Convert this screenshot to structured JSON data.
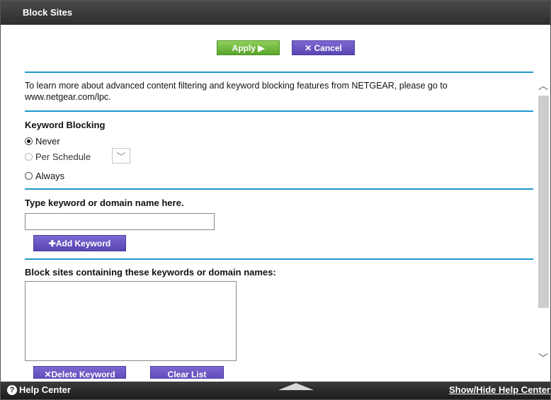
{
  "window": {
    "title": "Block Sites"
  },
  "toolbar": {
    "apply_label": "Apply",
    "apply_icon": "play-icon",
    "cancel_label": "Cancel",
    "cancel_icon": "x-icon"
  },
  "info": {
    "text": "To learn more about advanced content filtering and keyword blocking features from NETGEAR, please go to www.netgear.com/lpc."
  },
  "keyword_blocking": {
    "title": "Keyword Blocking",
    "options": [
      {
        "label": "Never",
        "selected": true,
        "enabled": true
      },
      {
        "label": "Per Schedule",
        "selected": false,
        "enabled": false
      },
      {
        "label": "Always",
        "selected": false,
        "enabled": true
      }
    ],
    "schedule_select_value": ""
  },
  "keyword_entry": {
    "title": "Type keyword or domain name here.",
    "value": "",
    "add_label": "Add Keyword"
  },
  "block_list": {
    "title": "Block sites containing these keywords or domain names:",
    "items": [],
    "delete_label": "Delete Keyword",
    "clear_label": "Clear List"
  },
  "help_bar": {
    "left_label": "Help Center",
    "right_label": "Show/Hide Help Center"
  },
  "colors": {
    "accent_line": "#1f98cc",
    "apply_green": "#6cb83a",
    "button_purple": "#6652c2"
  }
}
